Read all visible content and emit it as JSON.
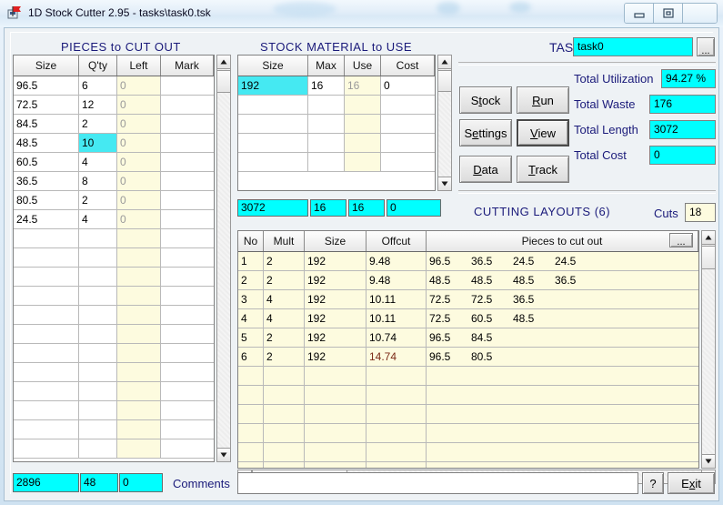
{
  "window": {
    "title": "1D Stock Cutter 2.95  -  tasks\\task0.tsk",
    "icon": "app-icon",
    "buttons": {
      "minimize": "minimize-icon",
      "restore": "restore-icon",
      "close": "close-icon"
    }
  },
  "pieces": {
    "header": "PIECES  to CUT OUT",
    "columns": [
      "Size",
      "Q'ty",
      "Left",
      "Mark"
    ],
    "rows": [
      {
        "size": "96.5",
        "qty": "6",
        "left": "0",
        "mark": ""
      },
      {
        "size": "72.5",
        "qty": "12",
        "left": "0",
        "mark": ""
      },
      {
        "size": "84.5",
        "qty": "2",
        "left": "0",
        "mark": ""
      },
      {
        "size": "48.5",
        "qty": "10",
        "left": "0",
        "mark": "",
        "selected": "qty"
      },
      {
        "size": "60.5",
        "qty": "4",
        "left": "0",
        "mark": ""
      },
      {
        "size": "36.5",
        "qty": "8",
        "left": "0",
        "mark": ""
      },
      {
        "size": "80.5",
        "qty": "2",
        "left": "0",
        "mark": ""
      },
      {
        "size": "24.5",
        "qty": "4",
        "left": "0",
        "mark": ""
      }
    ],
    "empty_rows": 12,
    "totals": [
      "2896",
      "48",
      "0"
    ]
  },
  "stock": {
    "header": "STOCK  MATERIAL  to USE",
    "columns": [
      "Size",
      "Max",
      "Use",
      "Cost"
    ],
    "rows": [
      {
        "size": "192",
        "max": "16",
        "use": "16",
        "cost": "0",
        "selected": "size"
      }
    ],
    "empty_rows": 4,
    "totals": [
      "3072",
      "16",
      "16",
      "0"
    ]
  },
  "task": {
    "label": "TASK",
    "value": "task0",
    "browse_label": "...",
    "buttons": [
      {
        "name": "stock",
        "pre": "S",
        "accel": "t",
        "post": "ock"
      },
      {
        "name": "run",
        "pre": "",
        "accel": "R",
        "post": "un"
      },
      {
        "name": "settings",
        "pre": "S",
        "accel": "e",
        "post": "ttings"
      },
      {
        "name": "view",
        "pre": "",
        "accel": "V",
        "post": "iew",
        "focused": true
      },
      {
        "name": "data",
        "pre": "",
        "accel": "D",
        "post": "ata"
      },
      {
        "name": "track",
        "pre": "",
        "accel": "T",
        "post": "rack"
      }
    ],
    "stats": [
      {
        "label": "Total Utilization",
        "value": "94.27 %"
      },
      {
        "label": "Total Waste",
        "value": "176"
      },
      {
        "label": "Total Length",
        "value": "3072"
      },
      {
        "label": "Total Cost",
        "value": "0"
      }
    ]
  },
  "layouts": {
    "header": "CUTTING  LAYOUTS  (6)",
    "cuts_label": "Cuts",
    "cuts_value": "18",
    "menu_label": "...",
    "columns": [
      "No",
      "Mult",
      "Size",
      "Offcut",
      "Pieces to cut out"
    ],
    "rows": [
      {
        "no": "1",
        "mult": "2",
        "size": "192",
        "offcut": "9.48",
        "pieces": [
          "96.5",
          "36.5",
          "24.5",
          "24.5"
        ]
      },
      {
        "no": "2",
        "mult": "2",
        "size": "192",
        "offcut": "9.48",
        "pieces": [
          "48.5",
          "48.5",
          "48.5",
          "36.5"
        ]
      },
      {
        "no": "3",
        "mult": "4",
        "size": "192",
        "offcut": "10.11",
        "pieces": [
          "72.5",
          "72.5",
          "36.5"
        ]
      },
      {
        "no": "4",
        "mult": "4",
        "size": "192",
        "offcut": "10.11",
        "pieces": [
          "72.5",
          "60.5",
          "48.5"
        ]
      },
      {
        "no": "5",
        "mult": "2",
        "size": "192",
        "offcut": "10.74",
        "pieces": [
          "96.5",
          "84.5"
        ]
      },
      {
        "no": "6",
        "mult": "2",
        "size": "192",
        "offcut": "14.74",
        "offcut_highlight": true,
        "pieces": [
          "96.5",
          "80.5"
        ]
      }
    ],
    "empty_rows": 6
  },
  "footer": {
    "comments_label": "Comments",
    "comments_value": "",
    "help_label": "?",
    "exit_pre": "E",
    "exit_accel": "x",
    "exit_post": "it"
  },
  "colors": {
    "accent_cyan": "#00ffff",
    "select_cyan": "#45e9f2",
    "readonly_yellow": "#fdfbdf",
    "label_blue": "#1a1a7a",
    "highlight_maroon": "#7c2b17"
  }
}
